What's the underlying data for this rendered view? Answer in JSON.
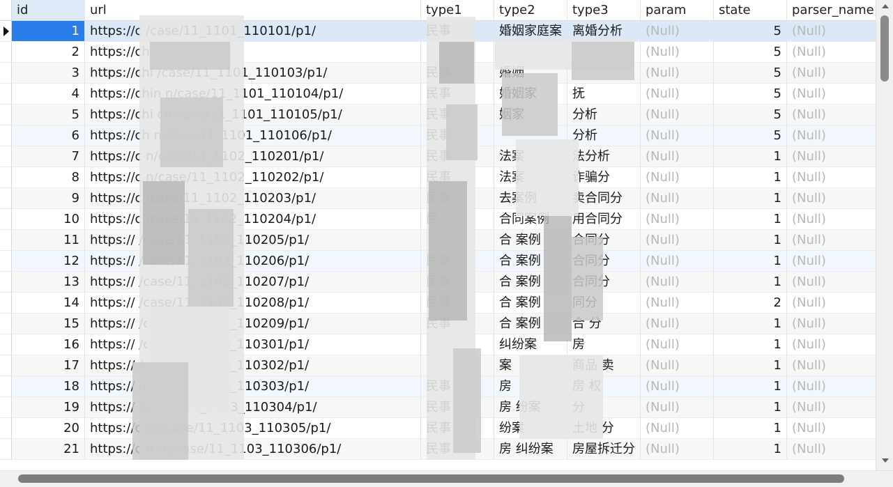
{
  "columns": {
    "id": "id",
    "url": "url",
    "type1": "type1",
    "type2": "type2",
    "type3": "type3",
    "param": "param",
    "state": "state",
    "parser_name": "parser_name"
  },
  "selected_row": 1,
  "rows": [
    {
      "id": "1",
      "url": "https://c            /case/11_1101_110101/p1/",
      "type1": "民事",
      "type2": "婚姻家庭案",
      "type3": "离婚分析",
      "param": "(Null)",
      "state": "5",
      "parser_name": "(Null)"
    },
    {
      "id": "2",
      "url": "https://ch",
      "type1": "",
      "type2": "",
      "type3": "",
      "param": "(Null)",
      "state": "5",
      "parser_name": "(Null)"
    },
    {
      "id": "3",
      "url": "https://chi            /case/11_1101_110103/p1/",
      "type1": "民事",
      "type2": "婚姻",
      "type3": "",
      "param": "(Null)",
      "state": "5",
      "parser_name": "(Null)"
    },
    {
      "id": "4",
      "url": "https://chin            n/case/11_1101_110104/p1/",
      "type1": "民事",
      "type2": "婚姻家",
      "type3": "抚",
      "param": "(Null)",
      "state": "5",
      "parser_name": "(Null)"
    },
    {
      "id": "5",
      "url": "https://chi            cn/case/11_1101_110105/p1/",
      "type1": "民事",
      "type2": "姻家",
      "type3": "分析",
      "param": "(Null)",
      "state": "5",
      "parser_name": "(Null)"
    },
    {
      "id": "6",
      "url": "https://ch            n/case/11_1101_110106/p1/",
      "type1": "民事",
      "type2": "",
      "type3": "分析",
      "param": "(Null)",
      "state": "5",
      "parser_name": "(Null)"
    },
    {
      "id": "7",
      "url": "https://c            n/case/11_1102_110201/p1/",
      "type1": "民事",
      "type2": "法案",
      "type3": "法分析",
      "param": "(Null)",
      "state": "1",
      "parser_name": "(Null)"
    },
    {
      "id": "8",
      "url": "https://c            n/case/11_1102_110202/p1/",
      "type1": "民事",
      "type2": "法案",
      "type3": "诈骗分",
      "param": "(Null)",
      "state": "1",
      "parser_name": "(Null)"
    },
    {
      "id": "9",
      "url": "https://c            /case/11_1102_110203/p1/",
      "type1": "民事",
      "type2": "去案例",
      "type3": "卖合同分",
      "param": "(Null)",
      "state": "1",
      "parser_name": "(Null)"
    },
    {
      "id": "10",
      "url": "https://c            /case/11_1102_110204/p1/",
      "type1": "民",
      "type2": "合同案例",
      "type3": "用合同分",
      "param": "(Null)",
      "state": "1",
      "parser_name": "(Null)"
    },
    {
      "id": "11",
      "url": "https://            /case/11_1102_110205/p1/",
      "type1": "",
      "type2": "合 案例",
      "type3": "合同分",
      "param": "(Null)",
      "state": "1",
      "parser_name": "(Null)"
    },
    {
      "id": "12",
      "url": "https://            /case/11_1102_110206/p1/",
      "type1": "民事",
      "type2": "合 案例",
      "type3": "合同分",
      "param": "(Null)",
      "state": "1",
      "parser_name": "(Null)"
    },
    {
      "id": "13",
      "url": "https://            /case/11_1102_110207/p1/",
      "type1": "民事",
      "type2": "合 案例",
      "type3": "合同分",
      "param": "(Null)",
      "state": "1",
      "parser_name": "(Null)"
    },
    {
      "id": "14",
      "url": "https://            /case/11_1102_110208/p1/",
      "type1": "民事",
      "type2": "合 案例",
      "type3": "同分",
      "param": "(Null)",
      "state": "2",
      "parser_name": "(Null)"
    },
    {
      "id": "15",
      "url": "https://            /case/11_1102_110209/p1/",
      "type1": "民事",
      "type2": "合 案例",
      "type3": "合 分",
      "param": "(Null)",
      "state": "1",
      "parser_name": "(Null)"
    },
    {
      "id": "16",
      "url": "https://            /case/11_1103_110301/p1/",
      "type1": "",
      "type2": "纠纷案",
      "type3": "房",
      "param": "(Null)",
      "state": "1",
      "parser_name": "(Null)"
    },
    {
      "id": "17",
      "url": "https://            /case/11_1103_110302/p1/",
      "type1": "",
      "type2": "案",
      "type3": "商品 卖",
      "param": "(Null)",
      "state": "1",
      "parser_name": "(Null)"
    },
    {
      "id": "18",
      "url": "https://            /case/11_1103_110303/p1/",
      "type1": "民事",
      "type2": "房",
      "type3": "房 权",
      "param": "(Null)",
      "state": "1",
      "parser_name": "(Null)"
    },
    {
      "id": "19",
      "url": "https://            n/case/11_1103_110304/p1/",
      "type1": "民事",
      "type2": "房 纷案",
      "type3": "分",
      "param": "(Null)",
      "state": "1",
      "parser_name": "(Null)"
    },
    {
      "id": "20",
      "url": "https://c            cn/case/11_1103_110305/p1/",
      "type1": "民事",
      "type2": "纷案",
      "type3": "土地 分",
      "param": "(Null)",
      "state": "1",
      "parser_name": "(Null)"
    },
    {
      "id": "21",
      "url": "https://c            v.cn/case/11_1103_110306/p1/",
      "type1": "民事",
      "type2": "房 纠纷案",
      "type3": "房屋拆迁分",
      "param": "(Null)",
      "state": "1",
      "parser_name": "(Null)"
    }
  ]
}
